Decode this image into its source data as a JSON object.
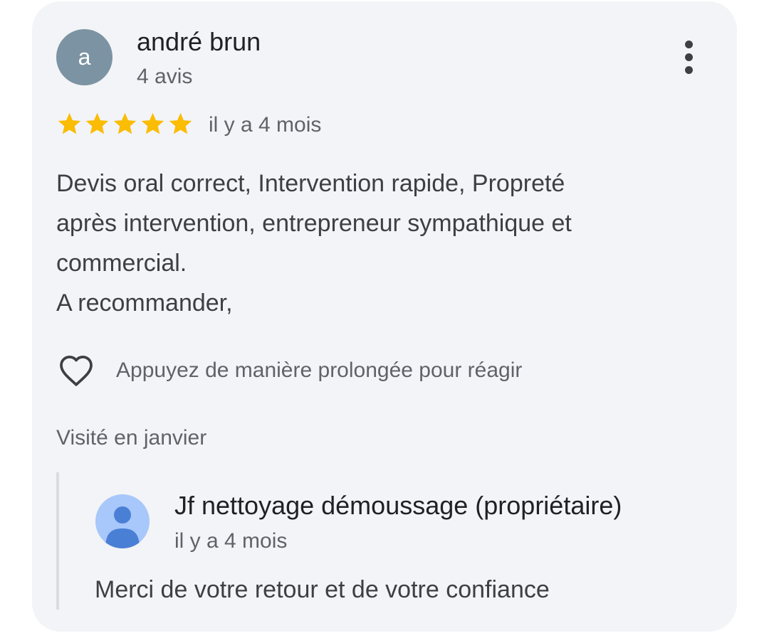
{
  "review": {
    "avatar_letter": "a",
    "avatar_color": "#7b93a2",
    "reviewer_name": "andré brun",
    "review_count": "4 avis",
    "rating": 5,
    "rating_max": 5,
    "star_color": "#fbbc04",
    "date": "il y a 4 mois",
    "body_lines": [
      "Devis oral correct, Intervention rapide, Propreté",
      "après intervention, entrepreneur sympathique et",
      "commercial.",
      "A recommander,"
    ],
    "more_icon": "more-vert-icon",
    "react_icon": "heart-outline-icon",
    "react_label": "Appuyez de manière prolongée pour réagir",
    "visited": "Visité en janvier"
  },
  "owner_reply": {
    "avatar_icon": "person-icon",
    "avatar_bg": "#a8c7fa",
    "avatar_fg": "#4a7fd6",
    "name": "Jf nettoyage démoussage (propriétaire)",
    "date": "il y a 4 mois",
    "text": "Merci de votre retour et de votre confiance"
  }
}
